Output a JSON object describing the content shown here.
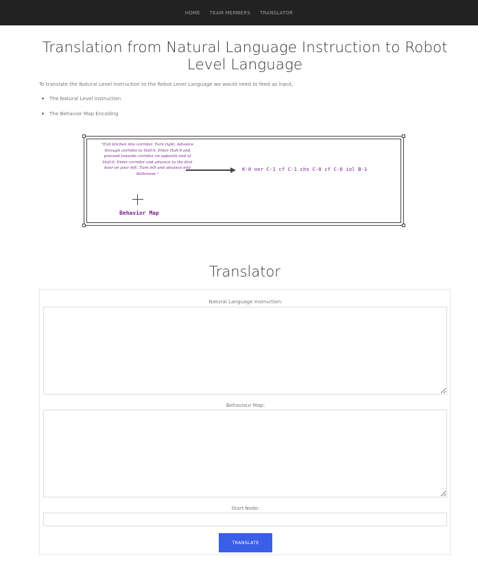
{
  "nav": {
    "items": [
      {
        "label": "HOME"
      },
      {
        "label": "TEAM MEMBERS"
      },
      {
        "label": "TRANSLATOR"
      }
    ]
  },
  "header": {
    "title": "Translation from Natural Language Instruction to Robot Level Language"
  },
  "intro": {
    "text": "To translate the Natural Level Instruction to the Robot Level Language we would need to feed as input,",
    "bullets": [
      {
        "label": "The Natural Level Instruction"
      },
      {
        "label": "The Behavior Map Encoding"
      }
    ]
  },
  "figure": {
    "natural_text": "\"Exit kitchen into corridor. Turn right. Advance through corridor to Hall-0. Enter Hall-0 and proceed towards corridor on opposite end of Hall-0. Enter corridor and advance to the first door on your left. Turn left and advance into Bathroom.\"",
    "behavior_map_label": "Behavior Map",
    "robot_text": "K-0 oor C-1 cf C-1 chs C-0 cf C-0 iol B-1",
    "colors": {
      "text": "#7a1f8c",
      "border": "#444444"
    }
  },
  "translator": {
    "heading": "Translator",
    "nl_label": "Natural Language Instruction:",
    "nl_value": "",
    "bm_label": "Behaviour Map:",
    "bm_value": "",
    "start_label": "Start Node:",
    "start_value": "",
    "button_label": "TRANSLATE",
    "button_color": "#3b5ee8"
  }
}
